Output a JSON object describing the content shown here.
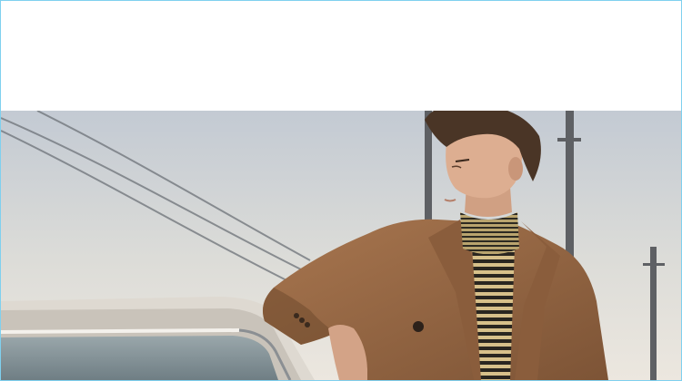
{
  "page": {
    "background": "#ffffff",
    "border_color": "#7fd0ef"
  },
  "photo": {
    "subject": "man-in-camel-coat-leaning-on-car",
    "colors": {
      "sky_top": "#c9cfd6",
      "sky_bottom": "#e7e3dc",
      "coat": "#9a6a45",
      "coat_shadow": "#6f4a2e",
      "hair": "#4a3526",
      "skin": "#d9a98c",
      "turtleneck": "#c9b27a",
      "car_roof": "#e3dfd8",
      "car_glass": "#7f8e94"
    }
  }
}
